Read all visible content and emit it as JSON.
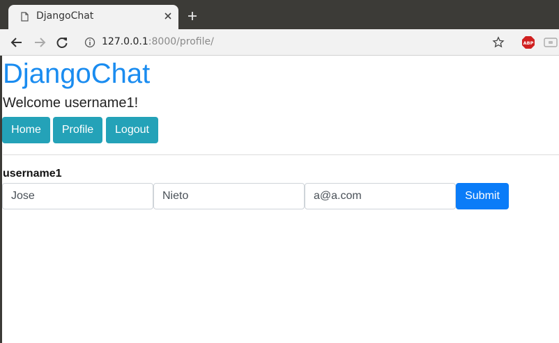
{
  "browser": {
    "tab_title": "DjangoChat",
    "url_host": "127.0.0.1",
    "url_rest": ":8000/profile/",
    "abp_label": "ABP"
  },
  "page": {
    "brand": "DjangoChat",
    "welcome": "Welcome username1!",
    "nav": {
      "home": "Home",
      "profile": "Profile",
      "logout": "Logout"
    },
    "form": {
      "username": "username1",
      "first_name": "Jose",
      "last_name": "Nieto",
      "email": "a@a.com",
      "submit": "Submit"
    }
  },
  "colors": {
    "brand": "#1a8cf0",
    "nav_button": "#24a2b8",
    "submit_button": "#0a7cf8"
  }
}
